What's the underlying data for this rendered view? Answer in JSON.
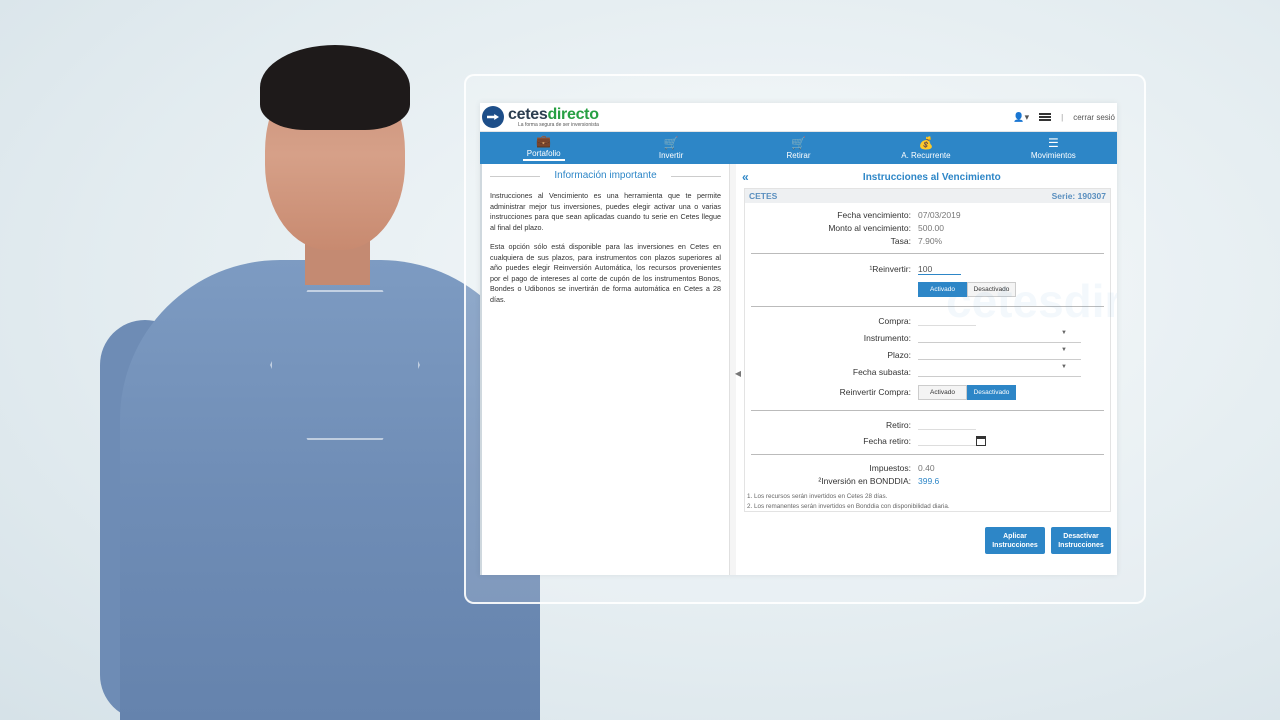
{
  "app": {
    "logo_name_a": "cetes",
    "logo_name_b": "directo",
    "logo_tag": "La forma segura de ser inversionista",
    "logout": "cerrar sesió",
    "sep": "|"
  },
  "nav": [
    {
      "label": "Portafolio",
      "icon": "briefcase-icon"
    },
    {
      "label": "Invertir",
      "icon": "cart-icon"
    },
    {
      "label": "Retirar",
      "icon": "cart-icon"
    },
    {
      "label": "A. Recurrente",
      "icon": "money-bag-icon"
    },
    {
      "label": "Movimientos",
      "icon": "list-icon"
    }
  ],
  "left": {
    "title": "Información importante",
    "p1": "Instrucciones al Vencimiento es una herramienta que te permite administrar mejor tus inversiones, puedes elegir activar una o varias instrucciones para que sean aplicadas cuando tu serie en Cetes llegue al final del plazo.",
    "p2": "Esta opción sólo está disponible para las inversiones en Cetes en cualquiera de sus plazos, para instrumentos con plazos superiores al año puedes elegir Reinversión Automática, los recursos provenientes por el pago de intereses al corte de cupón de los instrumentos Bonos, Bondes o Udibonos se invertirán de forma automática en Cetes a 28 días."
  },
  "right": {
    "title": "Instrucciones al Vencimiento",
    "instrument": "CETES",
    "serie": "Serie: 190307",
    "fecha_vencimiento_label": "Fecha vencimiento:",
    "fecha_vencimiento": "07/03/2019",
    "monto_label": "Monto al vencimiento:",
    "monto": "500.00",
    "tasa_label": "Tasa:",
    "tasa": "7.90%",
    "reinvertir_label": "¹Reinvertir:",
    "reinvertir_value": "100",
    "toggle_on": "Activado",
    "toggle_off": "Desactivado",
    "compra_label": "Compra:",
    "instrumento_label": "Instrumento:",
    "plazo_label": "Plazo:",
    "fecha_subasta_label": "Fecha subasta:",
    "reinvertir_compra_label": "Reinvertir Compra:",
    "retiro_label": "Retiro:",
    "fecha_retiro_label": "Fecha retiro:",
    "impuestos_label": "Impuestos:",
    "impuestos": "0.40",
    "bonddia_label": "²Inversión en BONDDIA:",
    "bonddia": "399.6",
    "note1": "1. Los recursos serán invertidos en Cetes 28 días.",
    "note2": "2. Los remanentes serán invertidos en Bonddia con disponibilidad diaria.",
    "btn_apply": "Aplicar Instrucciones",
    "btn_deactivate": "Desactivar Instrucciones"
  },
  "colors": {
    "primary": "#2d86c7",
    "brand_green": "#27a043",
    "brand_dark": "#2c3e50"
  }
}
